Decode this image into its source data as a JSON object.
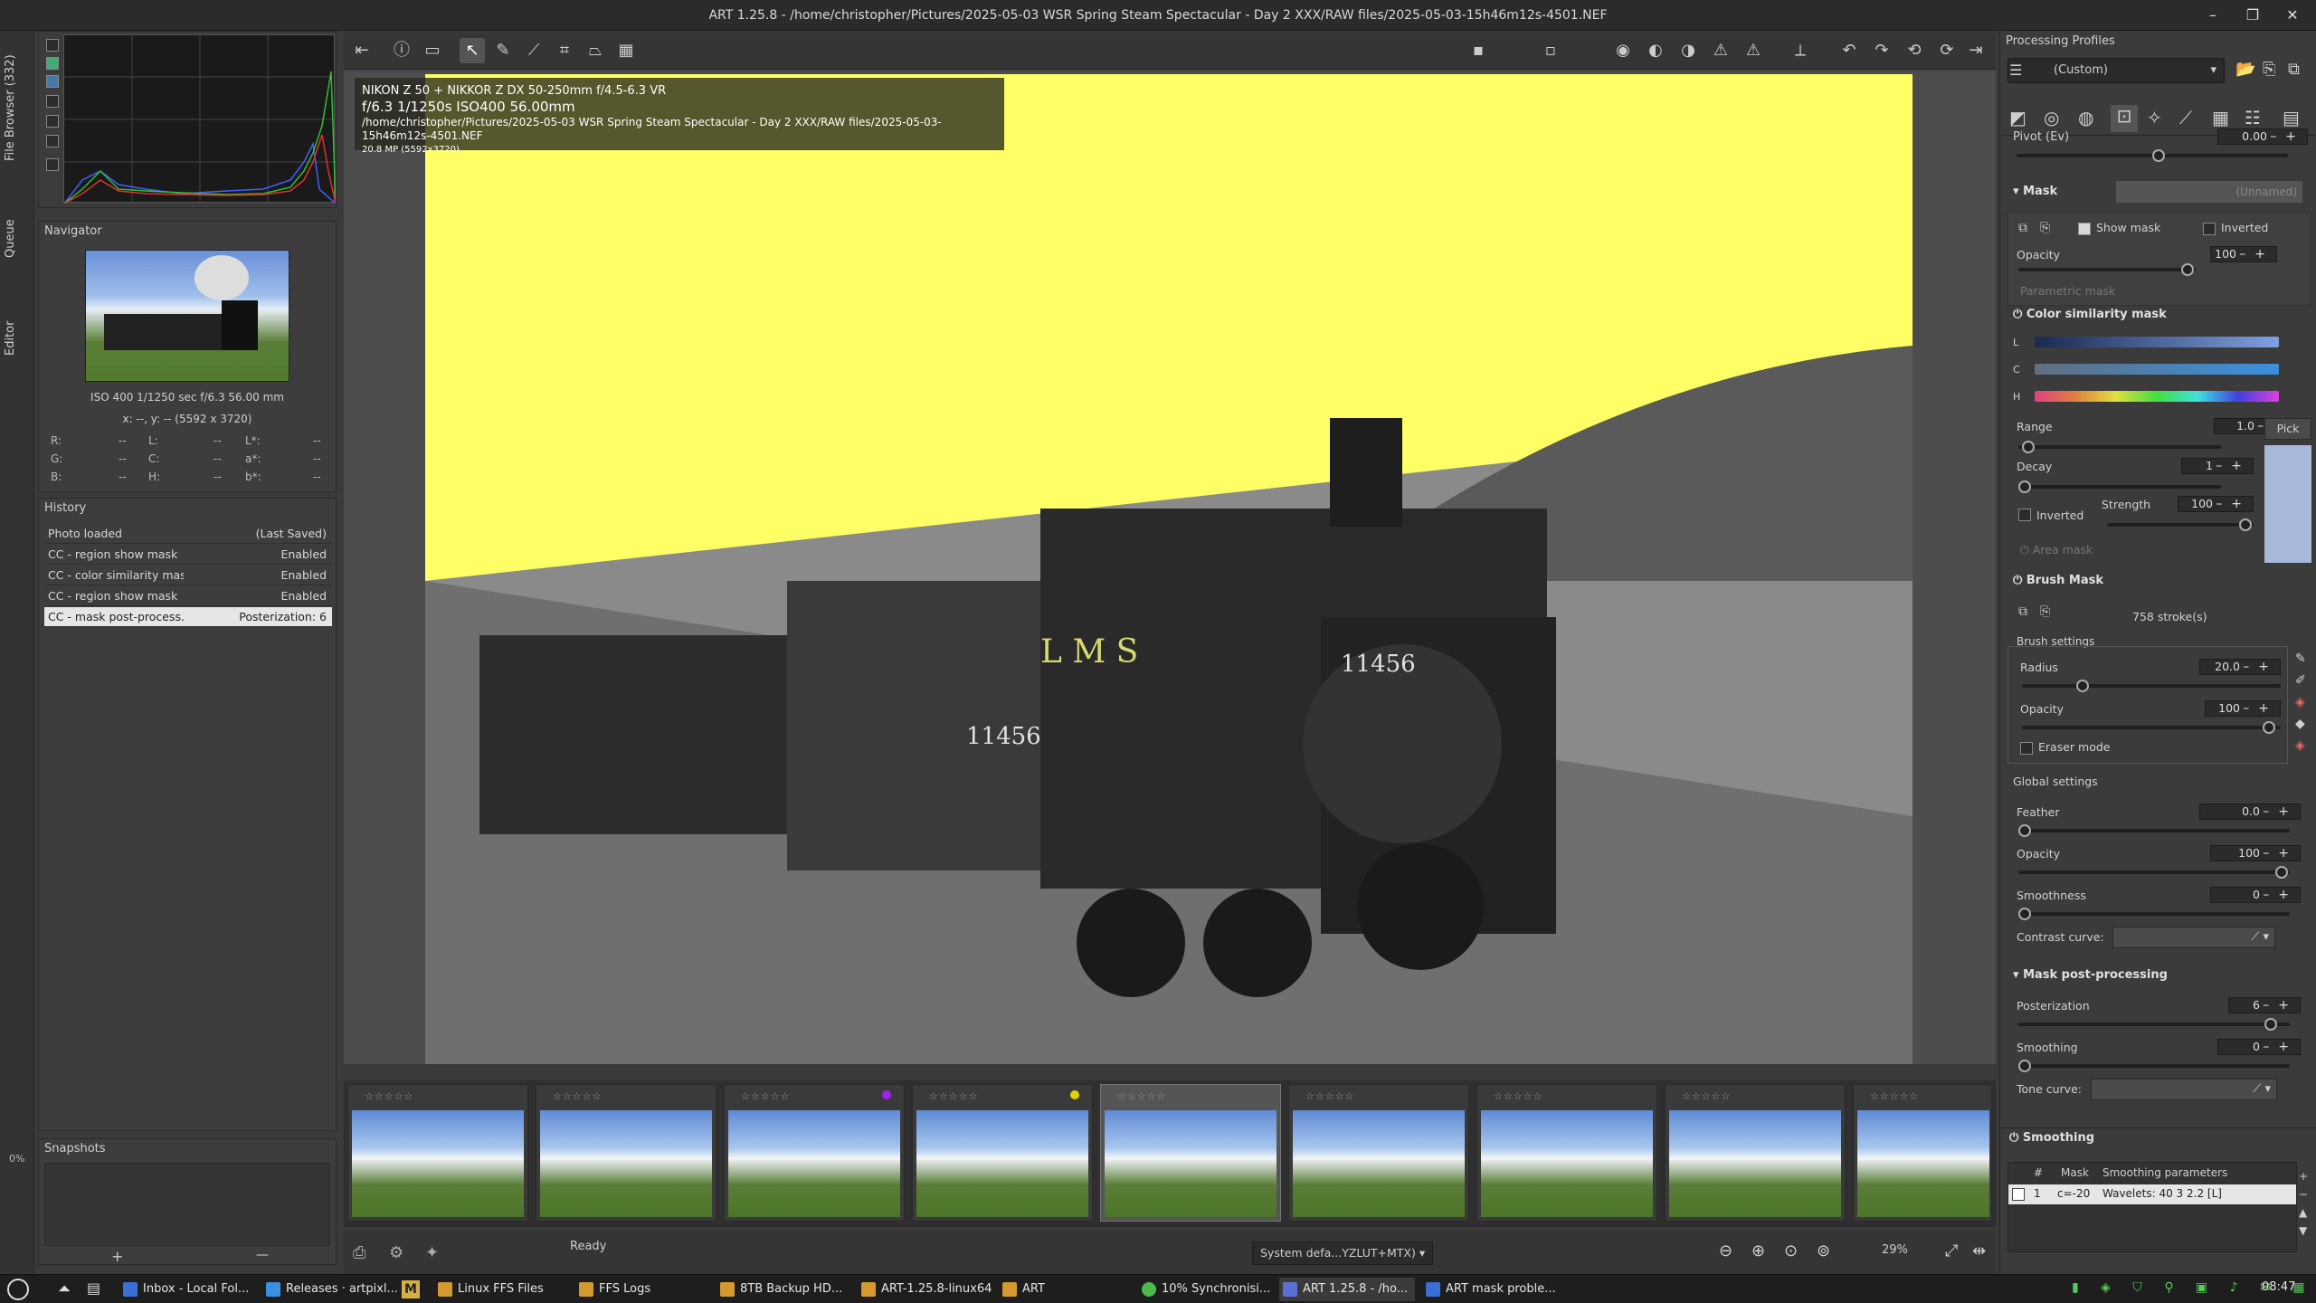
{
  "window": {
    "title": "ART 1.25.8 - /home/christopher/Pictures/2025-05-03 WSR Spring Steam Spectacular - Day 2 XXX/RAW files/2025-05-03-15h46m12s-4501.NEF",
    "controls": [
      "–",
      "❐",
      "✕"
    ]
  },
  "vtabs": {
    "file_browser": "File Browser (332)",
    "queue": "Queue",
    "editor": "Editor"
  },
  "navigator": {
    "title": "Navigator",
    "exif": "ISO 400   1/1250 sec   f/6.3   56.00 mm",
    "coords": "x: --, y: --   (5592 x 3720)",
    "rows": [
      {
        "a": "R:",
        "av": "--",
        "b": "L:",
        "bv": "--",
        "c": "L*:",
        "cv": "--"
      },
      {
        "a": "G:",
        "av": "--",
        "b": "C:",
        "bv": "--",
        "c": "a*:",
        "cv": "--"
      },
      {
        "a": "B:",
        "av": "--",
        "b": "H:",
        "bv": "--",
        "c": "b*:",
        "cv": "--"
      }
    ]
  },
  "history": {
    "title": "History",
    "rows": [
      {
        "label": "Photo loaded",
        "value": "(Last Saved)"
      },
      {
        "label": "CC - region show mask",
        "value": "Enabled"
      },
      {
        "label": "CC - color similarity mask",
        "value": "Enabled"
      },
      {
        "label": "CC - region show mask",
        "value": "Enabled"
      },
      {
        "label": "CC - mask post-process...",
        "value": "Posterization: 6"
      }
    ]
  },
  "snapshots": {
    "title": "Snapshots",
    "add": "+",
    "remove": "—"
  },
  "overlay": {
    "camera": "NIKON Z 50 + NIKKOR Z DX 50-250mm f/4.5-6.3 VR",
    "exposure": "f/6.3  1/1250s  ISO400  56.00mm",
    "path": "/home/christopher/Pictures/2025-05-03 WSR Spring Steam Spectacular - Day 2 XXX/RAW files/2025-05-03-15h46m12s-4501.NEF",
    "size": "20.8 MP (5592x3720)"
  },
  "photo_labels": {
    "loco_number": "11456",
    "lms": "L M S",
    "tender_number": "11456"
  },
  "status": {
    "text": "Ready",
    "profile": "System defa...YZLUT+MTX)",
    "zoom": "29%"
  },
  "right_panel": {
    "profiles_title": "Processing Profiles",
    "profile_value": "(Custom)",
    "pivot_label": "Pivot (Ev)",
    "pivot_value": "0.00",
    "mask_title": "Mask",
    "mask_name": "(Unnamed)",
    "show_mask": "Show mask",
    "inverted": "Inverted",
    "opacity_label": "Opacity",
    "opacity_value": "100",
    "parametric_mask": "Parametric mask",
    "color_similarity_title": "Color similarity mask",
    "l_label": "L",
    "c_label": "C",
    "h_label": "H",
    "range_label": "Range",
    "range_value": "1.0",
    "pick_label": "Pick",
    "decay_label": "Decay",
    "decay_value": "1",
    "strength_label": "Strength",
    "strength_value": "100",
    "cs_inverted": "Inverted",
    "area_mask": "Area mask",
    "brush_mask_title": "Brush Mask",
    "strokes": "758 stroke(s)",
    "brush_settings": "Brush settings",
    "radius_label": "Radius",
    "radius_value": "20.0",
    "brush_opacity_label": "Opacity",
    "brush_opacity_value": "100",
    "eraser_mode": "Eraser mode",
    "global_settings": "Global settings",
    "feather_label": "Feather",
    "feather_value": "0.0",
    "g_opacity_label": "Opacity",
    "g_opacity_value": "100",
    "smoothness_label": "Smoothness",
    "smoothness_value": "0",
    "contrast_curve_label": "Contrast curve:",
    "post_title": "Mask post-processing",
    "posterization_label": "Posterization",
    "posterization_value": "6",
    "smoothing_label": "Smoothing",
    "smoothing_value": "0",
    "tone_curve_label": "Tone curve:",
    "smoothing_section_title": "Smoothing",
    "table_hash": "#",
    "table_mask": "Mask",
    "table_params": "Smoothing parameters",
    "table_row_num": "1",
    "table_row_mask": "c=-20",
    "table_row_params": "Wavelets: 40 3 2.2 [L]"
  },
  "taskbar": {
    "items": [
      "Inbox - Local Fol...",
      "Releases · artpixl...",
      "Linux FFS Files",
      "FFS Logs",
      "8TB Backup HD...",
      "ART-1.25.8-linux64",
      "ART",
      "10% Synchronisi...",
      "ART 1.25.8 - /ho...",
      "ART mask proble..."
    ],
    "clock": "08:47"
  },
  "colors": {
    "mask_yellow": "#ffff66",
    "accent_purple": "#a020f0",
    "accent_yellow": "#e8d000"
  },
  "filmstrip": {
    "count": 9
  }
}
